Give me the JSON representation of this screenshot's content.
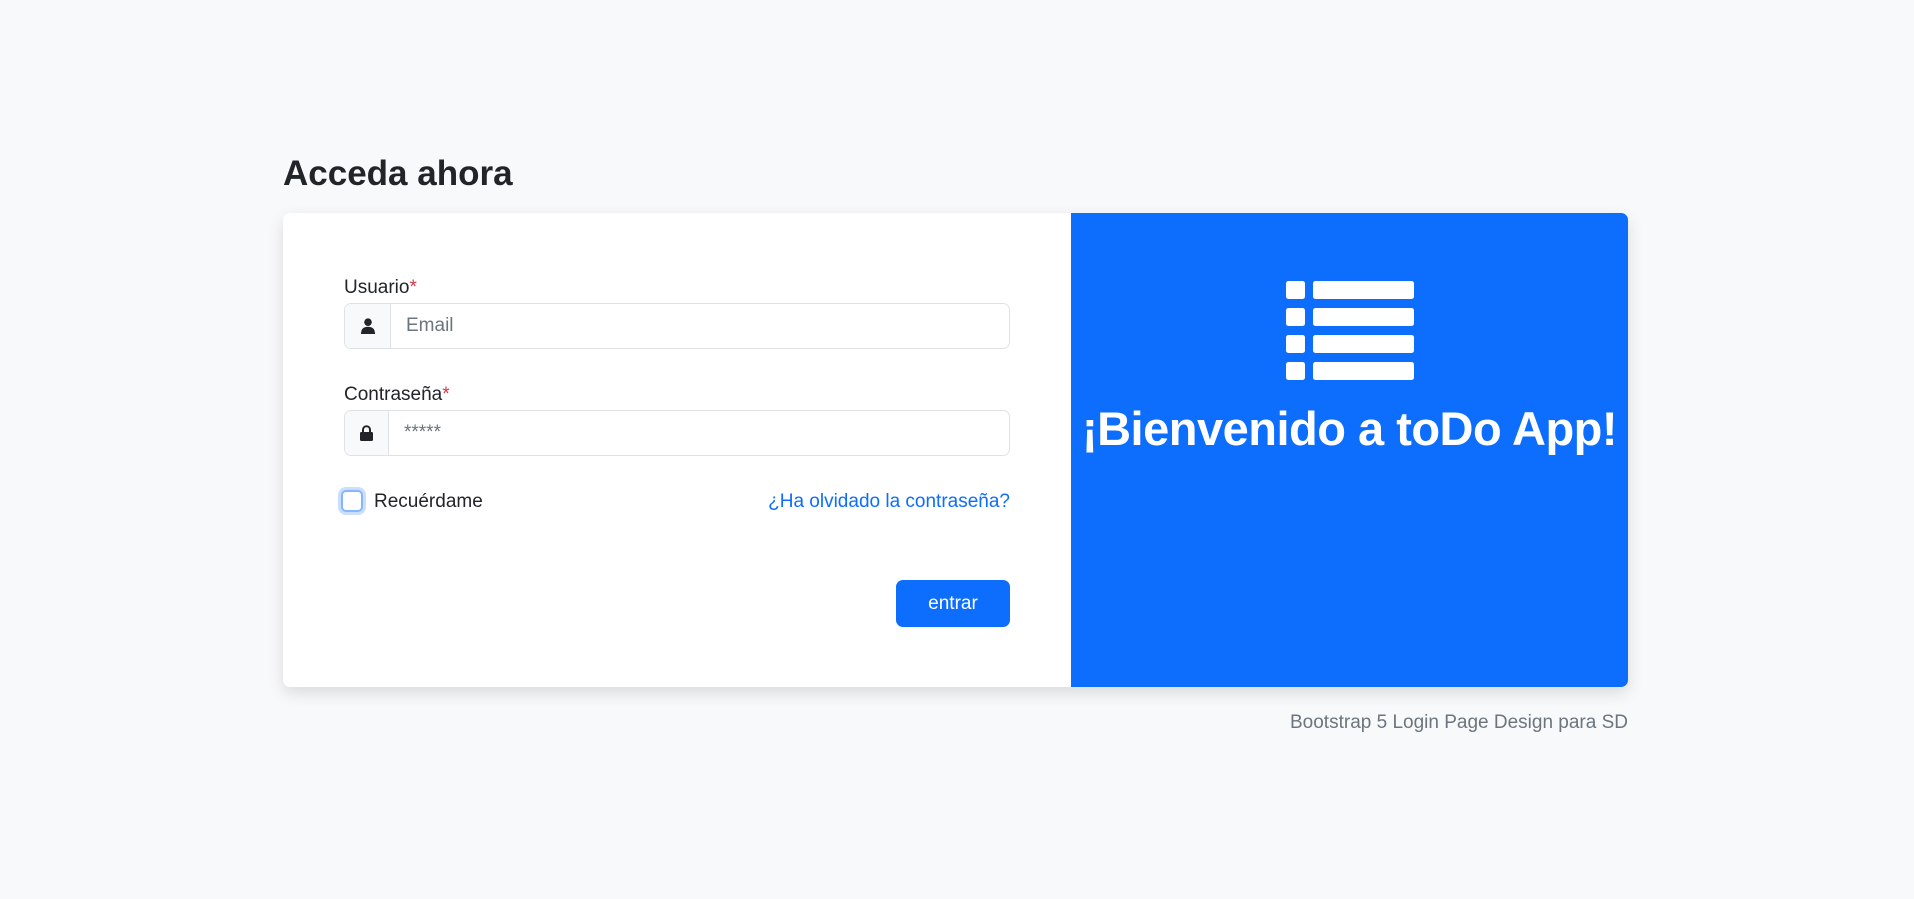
{
  "page": {
    "title": "Acceda ahora",
    "footer": "Bootstrap 5 Login Page Design para SD"
  },
  "form": {
    "username": {
      "label": "Usuario",
      "required_mark": "*",
      "placeholder": "Email",
      "value": "",
      "icon": "user-icon"
    },
    "password": {
      "label": "Contraseña",
      "required_mark": "*",
      "placeholder": "*****",
      "value": "",
      "icon": "lock-icon"
    },
    "remember": {
      "label": "Recuérdame",
      "checked": false
    },
    "forgot_link": "¿Ha olvidado la contraseña?",
    "submit_label": "entrar"
  },
  "brand": {
    "icon": "list-icon",
    "welcome": "¡Bienvenido a toDo App!"
  },
  "colors": {
    "primary": "#0d6efd",
    "required": "#dc3545",
    "background": "#f8f9fa",
    "muted": "#6c757d"
  }
}
